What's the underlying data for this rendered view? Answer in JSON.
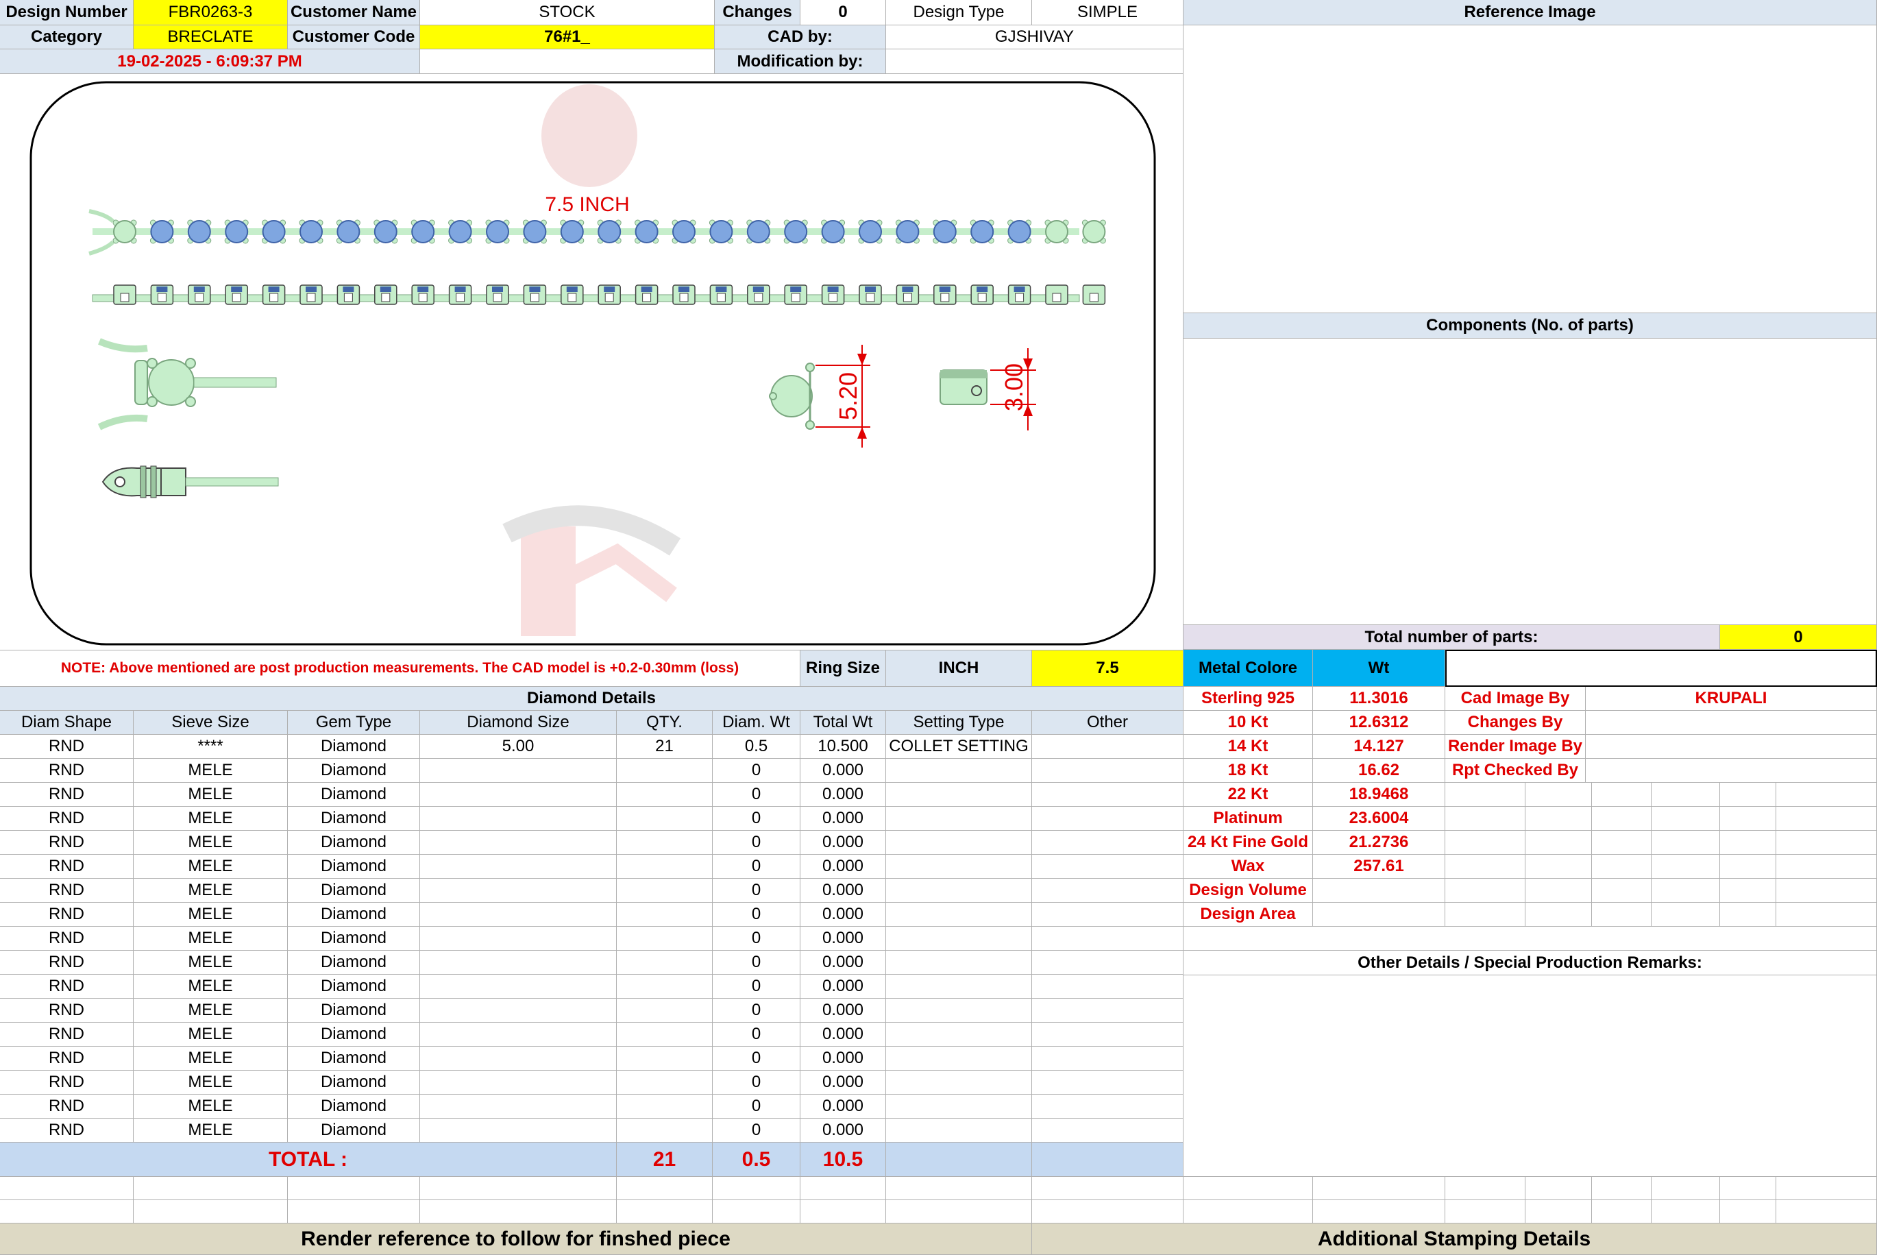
{
  "header": {
    "design_number_label": "Design Number",
    "design_number": "FBR0263-3",
    "customer_name_label": "Customer Name",
    "customer_name": "STOCK",
    "changes_label": "Changes",
    "changes": "0",
    "design_type_label": "Design Type",
    "design_type": "SIMPLE",
    "category_label": "Category",
    "category": "BRECLATE",
    "customer_code_label": "Customer Code",
    "customer_code": "76#1_",
    "cad_by_label": "CAD by:",
    "cad_by": "GJSHIVAY",
    "datetime": "19-02-2025 - 6:09:37 PM",
    "modification_by_label": "Modification by:",
    "modification_by": ""
  },
  "drawing": {
    "length_label": "7.5 INCH",
    "dim_height": "5.20",
    "dim_width": "3.00"
  },
  "note": {
    "text": "NOTE: Above mentioned are post production measurements. The CAD model is +0.2-0.30mm (loss)",
    "ring_size_label": "Ring Size",
    "ring_size_unit": "INCH",
    "ring_size_value": "7.5"
  },
  "diamond": {
    "title": "Diamond Details",
    "columns": [
      "Diam Shape",
      "Sieve Size",
      "Gem Type",
      "Diamond Size",
      "QTY.",
      "Diam. Wt",
      "Total Wt",
      "Setting Type",
      "Other"
    ],
    "rows": [
      [
        "RND",
        "****",
        "Diamond",
        "5.00",
        "21",
        "0.5",
        "10.500",
        "COLLET SETTING",
        ""
      ],
      [
        "RND",
        "MELE",
        "Diamond",
        "",
        "",
        "0",
        "0.000",
        "",
        ""
      ],
      [
        "RND",
        "MELE",
        "Diamond",
        "",
        "",
        "0",
        "0.000",
        "",
        ""
      ],
      [
        "RND",
        "MELE",
        "Diamond",
        "",
        "",
        "0",
        "0.000",
        "",
        ""
      ],
      [
        "RND",
        "MELE",
        "Diamond",
        "",
        "",
        "0",
        "0.000",
        "",
        ""
      ],
      [
        "RND",
        "MELE",
        "Diamond",
        "",
        "",
        "0",
        "0.000",
        "",
        ""
      ],
      [
        "RND",
        "MELE",
        "Diamond",
        "",
        "",
        "0",
        "0.000",
        "",
        ""
      ],
      [
        "RND",
        "MELE",
        "Diamond",
        "",
        "",
        "0",
        "0.000",
        "",
        ""
      ],
      [
        "RND",
        "MELE",
        "Diamond",
        "",
        "",
        "0",
        "0.000",
        "",
        ""
      ],
      [
        "RND",
        "MELE",
        "Diamond",
        "",
        "",
        "0",
        "0.000",
        "",
        ""
      ],
      [
        "RND",
        "MELE",
        "Diamond",
        "",
        "",
        "0",
        "0.000",
        "",
        ""
      ],
      [
        "RND",
        "MELE",
        "Diamond",
        "",
        "",
        "0",
        "0.000",
        "",
        ""
      ],
      [
        "RND",
        "MELE",
        "Diamond",
        "",
        "",
        "0",
        "0.000",
        "",
        ""
      ],
      [
        "RND",
        "MELE",
        "Diamond",
        "",
        "",
        "0",
        "0.000",
        "",
        ""
      ],
      [
        "RND",
        "MELE",
        "Diamond",
        "",
        "",
        "0",
        "0.000",
        "",
        ""
      ],
      [
        "RND",
        "MELE",
        "Diamond",
        "",
        "",
        "0",
        "0.000",
        "",
        ""
      ],
      [
        "RND",
        "MELE",
        "Diamond",
        "",
        "",
        "0",
        "0.000",
        "",
        ""
      ]
    ],
    "total_label": "TOTAL :",
    "total_qty": "21",
    "total_diam_wt": "0.5",
    "total_wt": "10.5"
  },
  "right": {
    "reference_image_title": "Reference Image",
    "components_title": "Components (No. of parts)",
    "total_parts_label": "Total number of parts:",
    "total_parts": "0",
    "metal_colore_label": "Metal Colore",
    "wt_label": "Wt",
    "metals": [
      {
        "name": "Sterling 925",
        "wt": "11.3016"
      },
      {
        "name": "10 Kt",
        "wt": "12.6312"
      },
      {
        "name": "14 Kt",
        "wt": "14.127"
      },
      {
        "name": "18 Kt",
        "wt": "16.62"
      },
      {
        "name": "22 Kt",
        "wt": "18.9468"
      },
      {
        "name": "Platinum",
        "wt": "23.6004"
      },
      {
        "name": "24 Kt Fine Gold",
        "wt": "21.2736"
      },
      {
        "name": "Wax",
        "wt": "257.61"
      },
      {
        "name": "Design Volume",
        "wt": ""
      },
      {
        "name": "Design Area",
        "wt": ""
      }
    ],
    "credits": [
      {
        "label": "Cad Image By",
        "value": "KRUPALI"
      },
      {
        "label": "Changes By",
        "value": ""
      },
      {
        "label": "Render Image By",
        "value": ""
      },
      {
        "label": "Rpt Checked By",
        "value": ""
      }
    ],
    "remarks_title": "Other Details / Special Production Remarks:"
  },
  "footer": {
    "render_reference": "Render reference to follow for finshed piece",
    "additional_stamping": "Additional Stamping Details"
  },
  "colors": {
    "label_bg": "#dce6f1",
    "highlight": "#ffff00",
    "red_text": "#e00000",
    "metal_header": "#00b0f0",
    "metal_green": "#c6eecb",
    "stone_blue": "#7fa6e0"
  }
}
